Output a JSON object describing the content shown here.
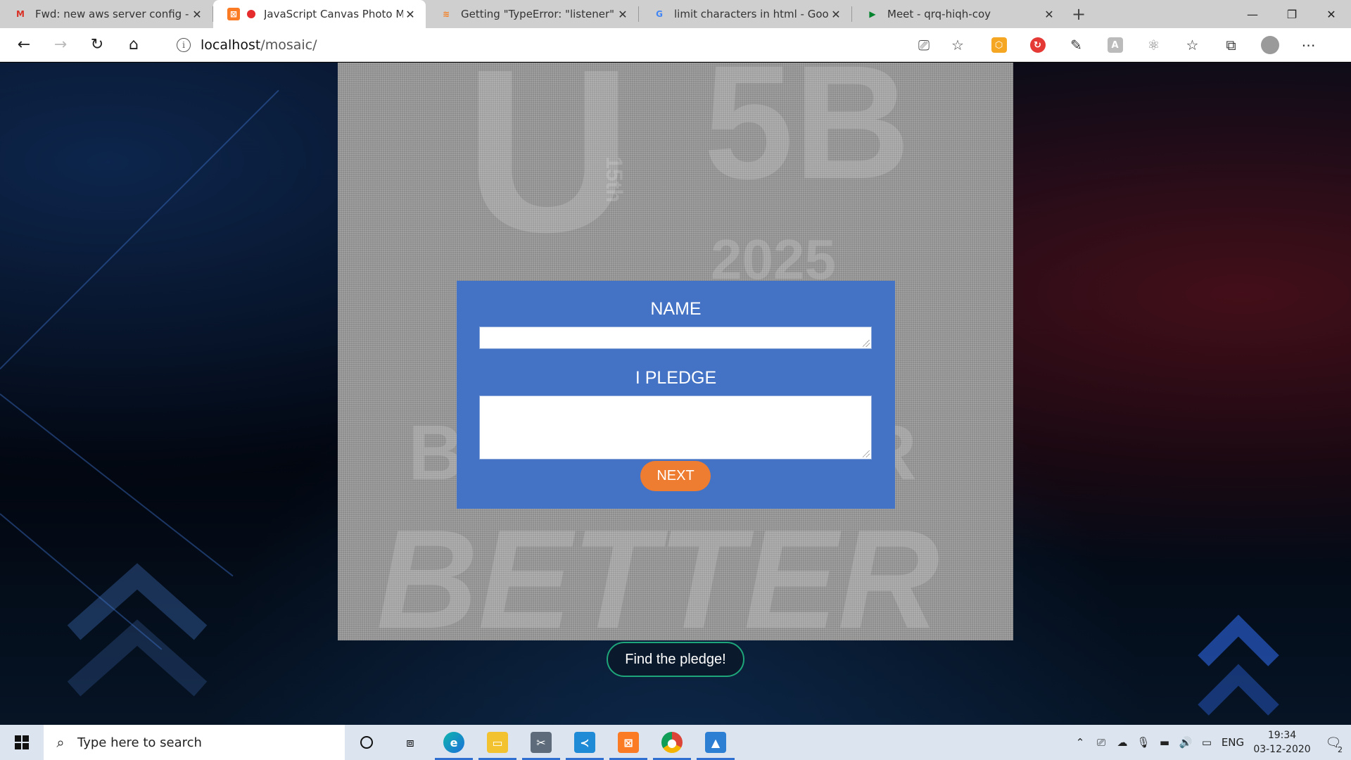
{
  "tabs": [
    {
      "label": "Fwd: new aws server config - pra",
      "favicon": "gmail-icon",
      "active": false
    },
    {
      "label": "JavaScript Canvas Photo Mo",
      "favicon": "xampp-icon",
      "active": true,
      "recording": true
    },
    {
      "label": "Getting \"TypeError: \"listener\" arg",
      "favicon": "stackoverflow-icon",
      "active": false
    },
    {
      "label": "limit characters in html - Google",
      "favicon": "google-icon",
      "active": false
    },
    {
      "label": "Meet - qrq-hiqh-coy",
      "favicon": "meet-icon",
      "active": false
    }
  ],
  "address_bar": {
    "host": "localhost",
    "path": "/mosaic/"
  },
  "form": {
    "name_label": "NAME",
    "name_value": "",
    "pledge_label": "I PLEDGE",
    "pledge_value": "",
    "next_label": "NEXT"
  },
  "find_button_label": "Find the pledge!",
  "mosaic_text": {
    "big_letter": "U",
    "side": "15th",
    "right_top": "5B",
    "year": "2025",
    "line1": "BE",
    "line1b": "ER",
    "line2": "BETTER"
  },
  "taskbar": {
    "search_placeholder": "Type here to search",
    "language": "ENG",
    "time": "19:34",
    "date": "03-12-2020",
    "notification_count": "2"
  },
  "colors": {
    "form_panel": "#4472c4",
    "next_button": "#ee7d31",
    "find_button_border": "#1ea67a",
    "mosaic_gray": "#8d8d8d"
  }
}
